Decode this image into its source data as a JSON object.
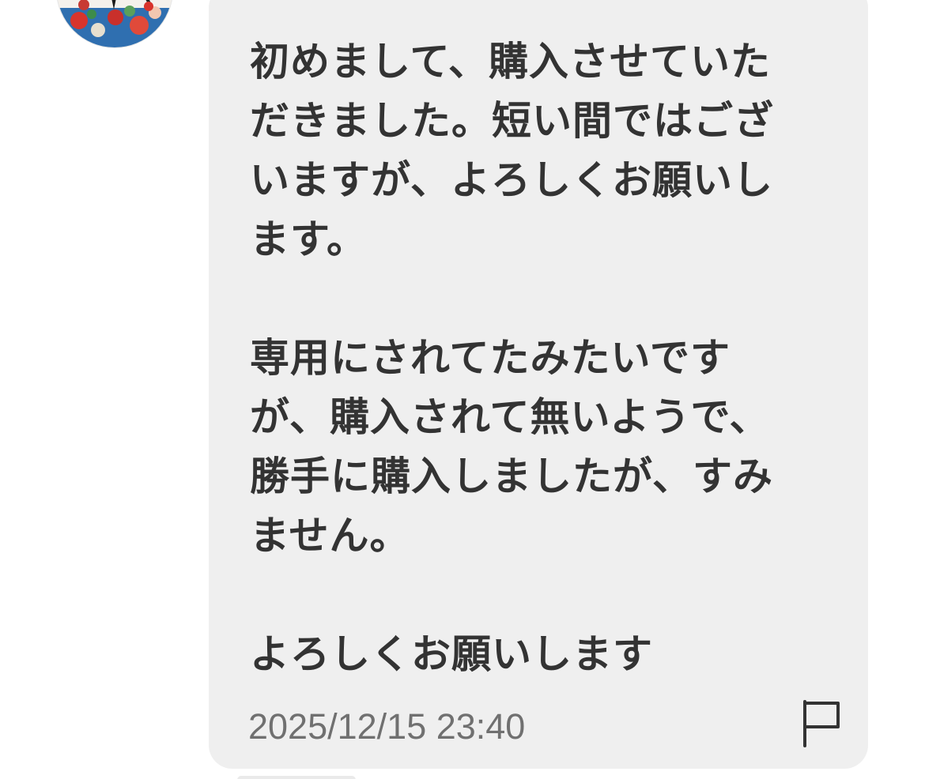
{
  "message": {
    "lines": [
      "初めまして、購入させていた",
      "だきました。短い間ではござ",
      "いますが、よろしくお願いし",
      "ます。",
      "",
      "専用にされてたみたいです",
      "が、購入されて無いようで、",
      "勝手に購入しましたが、すみ",
      "ません。",
      "",
      "よろしくお願いします"
    ],
    "timestamp": "2025/12/15 23:40"
  },
  "colors": {
    "bubble": "#efefef",
    "text": "#333333",
    "timestamp": "#707070",
    "background": "#ffffff"
  },
  "icons": {
    "report": "flag-icon",
    "sender": "avatar"
  }
}
